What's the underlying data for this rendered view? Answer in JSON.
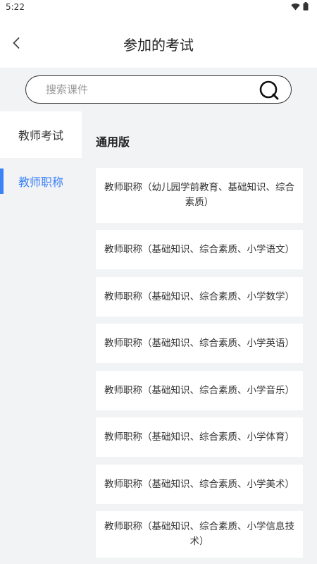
{
  "status_bar": {
    "time": "5:22"
  },
  "header": {
    "title": "参加的考试"
  },
  "search": {
    "placeholder": "搜索课件",
    "value": ""
  },
  "sidebar": {
    "items": [
      {
        "label": "教师考试",
        "active": false
      },
      {
        "label": "教师职称",
        "active": true
      }
    ]
  },
  "content": {
    "section_title": "通用版",
    "cards": [
      "教师职称（幼儿园学前教育、基础知识、综合素质）",
      "教师职称（基础知识、综合素质、小学语文）",
      "教师职称（基础知识、综合素质、小学数学）",
      "教师职称（基础知识、综合素质、小学英语）",
      "教师职称（基础知识、综合素质、小学音乐）",
      "教师职称（基础知识、综合素质、小学体育）",
      "教师职称（基础知识、综合素质、小学美术）",
      "教师职称（基础知识、综合素质、小学信息技术）"
    ]
  },
  "colors": {
    "accent": "#3b82f6",
    "background": "#f2f3f5"
  }
}
